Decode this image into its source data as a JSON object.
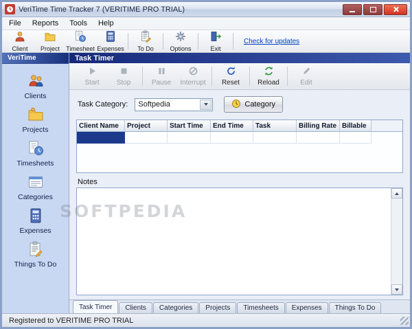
{
  "watermark": "SOFTPEDIA",
  "window": {
    "title": "VeriTime Time Tracker 7 (VERITIME PRO TRIAL)"
  },
  "menu": {
    "items": [
      "File",
      "Reports",
      "Tools",
      "Help"
    ]
  },
  "toolbar": {
    "items": [
      {
        "label": "Client"
      },
      {
        "label": "Project"
      },
      {
        "label": "Timesheet"
      },
      {
        "label": "Expenses"
      },
      {
        "label": "To Do"
      },
      {
        "label": "Options"
      },
      {
        "label": "Exit"
      }
    ],
    "update_link": "Check for updates"
  },
  "sidebar": {
    "header": "VeriTime",
    "items": [
      {
        "label": "Clients"
      },
      {
        "label": "Projects"
      },
      {
        "label": "Timesheets"
      },
      {
        "label": "Categories"
      },
      {
        "label": "Expenses"
      },
      {
        "label": "Things To Do"
      }
    ]
  },
  "main": {
    "panel_title": "Task Timer",
    "timer_buttons": [
      {
        "label": "Start",
        "enabled": false
      },
      {
        "label": "Stop",
        "enabled": false
      },
      {
        "label": "Pause",
        "enabled": false
      },
      {
        "label": "Interrupt",
        "enabled": false
      },
      {
        "label": "Reset",
        "enabled": true
      },
      {
        "label": "Reload",
        "enabled": true
      },
      {
        "label": "Edit",
        "enabled": false
      }
    ],
    "task_category": {
      "label": "Task Category:",
      "value": "Softpedia",
      "button": "Category"
    },
    "table": {
      "columns": [
        "Client Name",
        "Project",
        "Start Time",
        "End Time",
        "Task",
        "Billing Rate",
        "Billable"
      ],
      "rows": [
        [
          "",
          "",
          "",
          "",
          "",
          "",
          ""
        ]
      ]
    },
    "notes_label": "Notes"
  },
  "tabs": [
    {
      "label": "Task Timer",
      "active": true
    },
    {
      "label": "Clients",
      "active": false
    },
    {
      "label": "Categories",
      "active": false
    },
    {
      "label": "Projects",
      "active": false
    },
    {
      "label": "Timesheets",
      "active": false
    },
    {
      "label": "Expenses",
      "active": false
    },
    {
      "label": "Things To Do",
      "active": false
    }
  ],
  "statusbar": {
    "text": "Registered to VERITIME PRO TRIAL"
  },
  "colors": {
    "selection_navy": "#1c3a8c",
    "panel_header_navy": "#16297a",
    "link_blue": "#0040c8",
    "sidebar_blue": "#c9d8f2"
  }
}
